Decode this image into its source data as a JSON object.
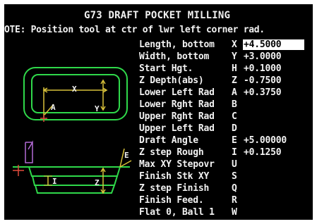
{
  "title": "G73 DRAFT POCKET MILLING",
  "note": "OTE: Position tool at ctr of lwr left corner rad.",
  "diagram_labels": {
    "top_x": "X",
    "top_y": "Y",
    "top_a": "A",
    "side_e": "E",
    "side_i": "I",
    "side_z": "Z"
  },
  "parameters": [
    {
      "label": "Length, bottom",
      "key": "X",
      "value": "+4.5000",
      "active": true
    },
    {
      "label": "Width, bottom",
      "key": "Y",
      "value": "+3.0000",
      "active": false
    },
    {
      "label": "Start Hgt.",
      "key": "H",
      "value": "+0.1000",
      "active": false
    },
    {
      "label": "Z Depth(abs)",
      "key": "Z",
      "value": "-0.7500",
      "active": false
    },
    {
      "label": "Lower Left Rad",
      "key": "A",
      "value": "+0.3750",
      "active": false
    },
    {
      "label": "Lower Rght Rad",
      "key": "B",
      "value": "",
      "active": false
    },
    {
      "label": "Upper Rght Rad",
      "key": "C",
      "value": "",
      "active": false
    },
    {
      "label": "Upper Left Rad",
      "key": "D",
      "value": "",
      "active": false
    },
    {
      "label": "Draft Angle",
      "key": "E",
      "value": "+5.00000",
      "active": false
    },
    {
      "label": "Z step Rough",
      "key": "I",
      "value": "+0.1250",
      "active": false
    },
    {
      "label": "Max XY Stepovr",
      "key": "U",
      "value": "",
      "active": false
    },
    {
      "label": "Finish Stk XY",
      "key": "S",
      "value": "",
      "active": false
    },
    {
      "label": "Z step Finish",
      "key": "Q",
      "value": "",
      "active": false
    },
    {
      "label": "Finish Feed.",
      "key": "R",
      "value": "",
      "active": false
    },
    {
      "label": "Flat 0, Ball 1",
      "key": "W",
      "value": "",
      "active": false
    }
  ],
  "colors": {
    "background": "#000000",
    "text": "#f2f2f2",
    "pocket_outline": "#2fd84a",
    "dimension": "#d8c13a",
    "tool": "#b36ad6",
    "center_mark": "#e04a3a",
    "highlight_bg": "#ffffff"
  }
}
